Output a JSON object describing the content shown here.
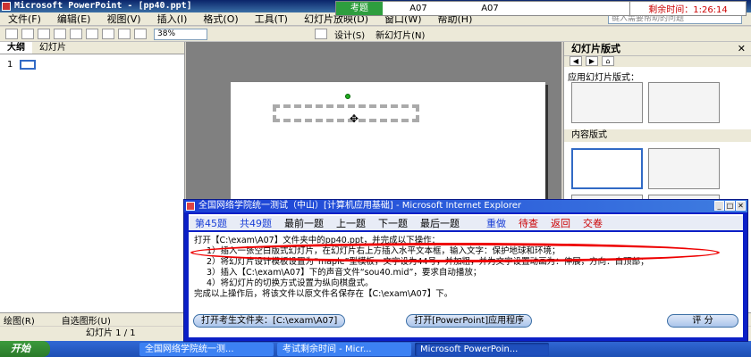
{
  "app": {
    "title": "Microsoft PowerPoint - [pp40.ppt]"
  },
  "exam": {
    "label": "考题",
    "id1": "A07",
    "id2": "A07",
    "timer_label": "剩余时间：",
    "timer": "1:26:14"
  },
  "menu": [
    "文件(F)",
    "编辑(E)",
    "视图(V)",
    "插入(I)",
    "格式(O)",
    "工具(T)",
    "幻灯片放映(D)",
    "窗口(W)",
    "帮助(H)"
  ],
  "help_placeholder": "键入需要帮助的问题",
  "toolbar": {
    "zoom": "38%",
    "design": "设计(S)",
    "new_slide": "新幻灯片(N)"
  },
  "left_tabs": [
    "大纲",
    "幻灯片"
  ],
  "slide_num": "1",
  "pane": {
    "title": "幻灯片版式",
    "apply": "应用幻灯片版式：",
    "content": "内容版式"
  },
  "draw": {
    "label": "绘图(R)",
    "autoshape": "自选图形(U)"
  },
  "status": "幻灯片 1 / 1",
  "ie": {
    "title": "全国网络学院统一测试（中山）[计算机应用基础] - Microsoft Internet Explorer",
    "nav": {
      "current": "第45题",
      "total": "共49题",
      "first": "最前一题",
      "prev": "上一题",
      "next": "下一题",
      "last": "最后一题",
      "submit": "重做",
      "wait": "待查",
      "back": "返回",
      "hand": "交卷"
    },
    "line1": "打开【C:\\exam\\A07】文件夹中的pp40.ppt，并完成以下操作：",
    "line2": "1）插入一张空白版式幻灯片，在幻灯片右上方插入水平文本框，输入文字：保护地球和环境；",
    "line3": "2）将幻灯片设计模板设置为“maple”型模板，文字设为44号，并加粗，并为文字设置动画为：伸展，方向：自顶部；",
    "line4": "3）插入【C:\\exam\\A07】下的声音文件“sou40.mid”，要求自动播放；",
    "line5": "4）将幻灯片的切换方式设置为纵向棋盘式。",
    "line6": "完成以上操作后，将该文件以原文件名保存在【C:\\exam\\A07】下。",
    "btn_open_folder": "打开考生文件夹：[C:\\exam\\A07]",
    "btn_open_app": "打开[PowerPoint]应用程序",
    "btn_score": "评 分"
  },
  "taskbar": {
    "start": "开始",
    "t1": "全国网络学院统一测...",
    "t2": "考试剩余时间 - Micr...",
    "t3": "Microsoft PowerPoin..."
  }
}
